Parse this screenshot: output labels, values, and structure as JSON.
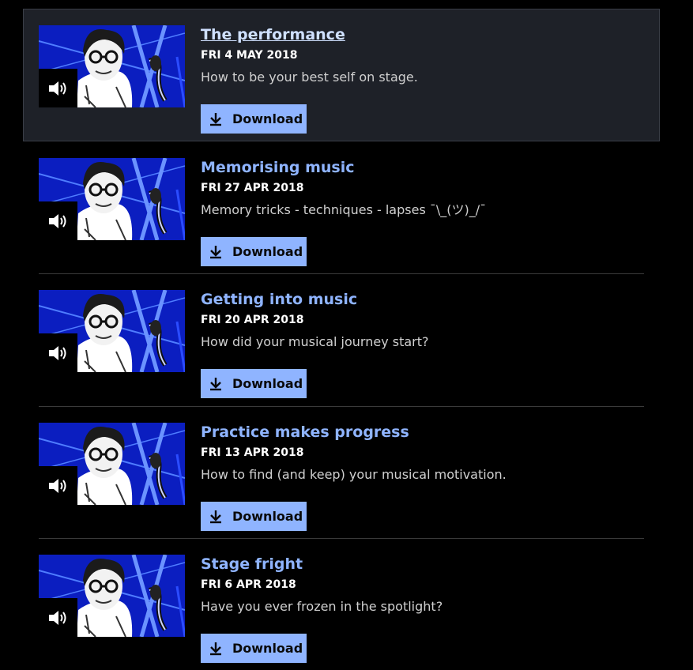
{
  "episodes": [
    {
      "title": "The performance",
      "date": "FRI 4 MAY 2018",
      "description": "How to be your best self on stage.",
      "download_label": "Download",
      "thumb_icon": "speaker-icon"
    },
    {
      "title": "Memorising music",
      "date": "FRI 27 APR 2018",
      "description": "Memory tricks - techniques - lapses ¯\\_(ツ)_/¯",
      "download_label": "Download",
      "thumb_icon": "speaker-icon"
    },
    {
      "title": "Getting into music",
      "date": "FRI 20 APR 2018",
      "description": "How did your musical journey start?",
      "download_label": "Download",
      "thumb_icon": "speaker-icon"
    },
    {
      "title": "Practice makes progress",
      "date": "FRI 13 APR 2018",
      "description": "How to find (and keep) your musical motivation.",
      "download_label": "Download",
      "thumb_icon": "speaker-icon"
    },
    {
      "title": "Stage fright",
      "date": "FRI 6 APR 2018",
      "description": "Have you ever frozen in the spotlight?",
      "download_label": "Download",
      "thumb_icon": "speaker-icon"
    }
  ],
  "colors": {
    "link": "#8fb4ff",
    "link_active": "#cfe0ff",
    "button_bg": "#8fb4ff",
    "highlight_bg": "#1e2128",
    "page_bg": "#000000"
  }
}
